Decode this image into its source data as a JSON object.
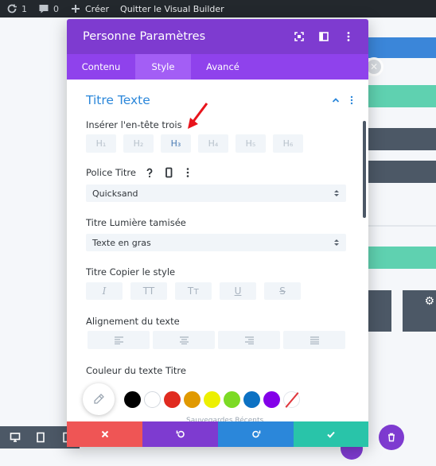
{
  "adminbar": {
    "updates_count": "1",
    "comments_count": "0",
    "create_label": "Créer",
    "exit_label": "Quitter le Visual Builder"
  },
  "modal": {
    "title": "Personne Paramètres",
    "tabs": [
      {
        "label": "Contenu",
        "active": false
      },
      {
        "label": "Style",
        "active": true
      },
      {
        "label": "Avancé",
        "active": false
      }
    ],
    "section_title": "Titre Texte",
    "heading_level": {
      "label": "Insérer l'en-tête trois",
      "options": [
        "H₁",
        "H₂",
        "H₃",
        "H₄",
        "H₅",
        "H₆"
      ],
      "selected": "H₃"
    },
    "font": {
      "label": "Police Titre",
      "value": "Quicksand"
    },
    "font_weight": {
      "label": "Titre Lumière tamisée",
      "value": "Texte en gras"
    },
    "font_style": {
      "label": "Titre Copier le style",
      "options": [
        "I",
        "TT",
        "Tт",
        "U",
        "S"
      ]
    },
    "alignment": {
      "label": "Alignement du texte",
      "options": [
        "left",
        "center",
        "right",
        "justify"
      ]
    },
    "text_color": {
      "label": "Couleur du texte Titre",
      "swatches": [
        "#000000",
        "#ffffff",
        "#e02b20",
        "#e09900",
        "#edf000",
        "#7cda24",
        "#0c71c3",
        "#8300e9"
      ]
    },
    "saved_links": "Sauvegardes    Récents"
  },
  "colors": {
    "modal_header": "#7e3bd0",
    "tabs_bar": "#8f42ec",
    "active_tab": "#a35ef5",
    "accent_blue": "#2b87da",
    "cancel": "#ef5555",
    "undo": "#7e3bd0",
    "redo": "#2b87da",
    "save": "#29c4a9"
  }
}
